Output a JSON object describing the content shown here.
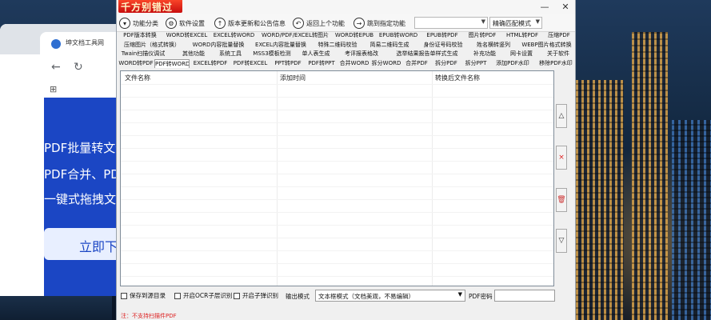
{
  "browser": {
    "tab_title": "坤文档工具网",
    "back_icon": "←",
    "refresh_icon": "↻",
    "apps_icon": "⊞",
    "hero_lines": [
      "PDF批量转文件",
      "PDF合并、PD",
      "一键式拖拽文件"
    ],
    "cta_label": "立即下"
  },
  "app": {
    "logo_text": "千方别错过",
    "window_controls": {
      "minimize": "—",
      "close": "✕"
    },
    "toolbar": {
      "items": [
        {
          "label": "功能分类",
          "icon": "▾"
        },
        {
          "label": "软件设置",
          "icon": "⚙"
        },
        {
          "label": "版本更新和公告信息",
          "icon": "↑"
        },
        {
          "label": "返回上个功能",
          "icon": "↶"
        },
        {
          "label": "跳到指定功能",
          "icon": "→"
        }
      ],
      "dropdown1_value": "",
      "match_mode_value": "精确匹配模式"
    },
    "tabs": {
      "row1": [
        "PDF版本转换",
        "WORD转EXCEL",
        "EXCEL转WORD",
        "WORD/PDF/EXCEL转图片",
        "WORD转EPUB",
        "EPUB转WORD",
        "EPUB转PDF",
        "图片转PDF",
        "HTML转PDF",
        "压缩PDF"
      ],
      "row2": [
        "压缩图片（格式转换）",
        "WORD内容批量替换",
        "EXCEL内容批量替换",
        "特殊二维码校验",
        "简易二维码生成",
        "身份证号码校验",
        "姓名横转竖列",
        "WEBP图片格式转换"
      ],
      "row3": [
        "Twain扫描仪调试",
        "其他功能",
        "系统工具",
        "MSS3模板检测",
        "单人表生成",
        "考评报表格改",
        "选举结果报告单样式生成",
        "补充功能",
        "网卡设置",
        "关于软件"
      ],
      "row4": [
        "WORD转PDF",
        "PDF转WORD",
        "EXCEL转PDF",
        "PDF转EXCEL",
        "PPT转PDF",
        "PDF转PPT",
        "合并WORD",
        "拆分WORD",
        "合并PDF",
        "拆分PDF",
        "拆分PPT",
        "添加PDF水印",
        "移除PDF水印"
      ],
      "selected": "PDF转WORD"
    },
    "grid": {
      "columns": [
        "文件名称",
        "添加时间",
        "转换后文件名称"
      ]
    },
    "side_buttons": {
      "up": "△",
      "delete": "×",
      "clear": "🗑",
      "down": "▽"
    },
    "bottom": {
      "save_to_source": "保存到源目录",
      "enable_ocr": "开启OCR子层识别",
      "enable_subpixel": "开启子弹识别",
      "output_mode_label": "输出模式",
      "output_mode_value": "文本框模式（文档美观，不易编辑）",
      "pdf_password_label": "PDF密码",
      "pdf_password_value": ""
    },
    "note": "注：不支持扫描件PDF"
  }
}
